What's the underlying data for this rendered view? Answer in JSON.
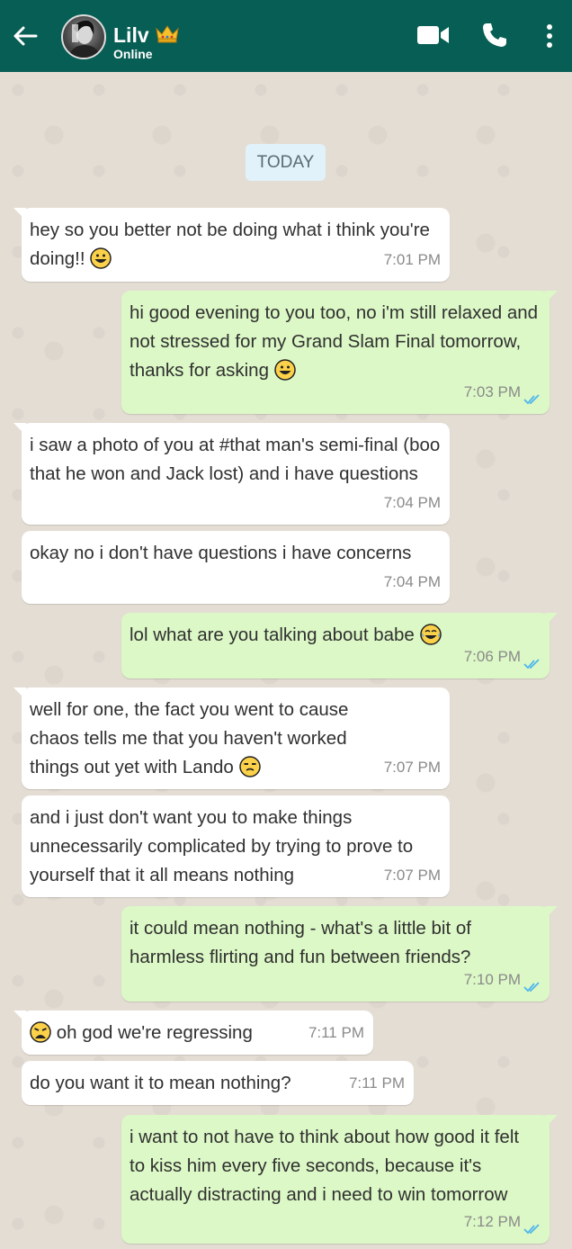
{
  "header": {
    "contact_name": "Lilv",
    "status": "Online",
    "icons": [
      "back-arrow-icon",
      "crown-icon",
      "video-call-icon",
      "phone-icon",
      "more-options-icon"
    ]
  },
  "colors": {
    "header": "#075e54",
    "incoming": "#ffffff",
    "outgoing": "#dcf8c6",
    "ticks": "#4fb6ec"
  },
  "date_badge": "TODAY",
  "messages": [
    {
      "dir": "in",
      "text": "hey so you better not be doing what i think you're doing!!",
      "emoji": "grinning-face-icon",
      "time": "7:01 PM"
    },
    {
      "dir": "out",
      "text": "hi good evening to you too, no i'm still relaxed and not stressed for my Grand Slam Final tomorrow, thanks for asking",
      "emoji": "grinning-face-icon",
      "time": "7:03 PM"
    },
    {
      "dir": "in",
      "text": "i saw a photo of you at #that man's semi-final (boo that he won and Jack lost) and i have questions",
      "time": "7:04 PM"
    },
    {
      "dir": "in",
      "text": "okay no i don't have questions i have concerns",
      "time": "7:04 PM"
    },
    {
      "dir": "out",
      "text": "lol what are you talking about babe",
      "emoji": "tears-of-joy-icon",
      "time": "7:06 PM"
    },
    {
      "dir": "in",
      "text": "well for one, the fact you went to cause chaos tells me that you haven't worked things out yet with Lando",
      "emoji": "unamused-face-icon",
      "time": "7:07 PM"
    },
    {
      "dir": "in",
      "text": "and i just don't want you to make things unnecessarily complicated by trying to prove to yourself that it all means nothing",
      "time": "7:07 PM"
    },
    {
      "dir": "out",
      "text": "it could mean nothing - what's a little bit of harmless flirting and fun between friends?",
      "time": "7:10 PM"
    },
    {
      "dir": "in",
      "text": "oh god we're regressing",
      "emoji_lead": "weary-face-icon",
      "time": "7:11 PM"
    },
    {
      "dir": "in",
      "text": "do you want it to mean nothing?",
      "time": "7:11 PM"
    },
    {
      "dir": "out",
      "text": "i want to not have to think about how good it felt to kiss him every five seconds, because it's actually distracting and i need to win tomorrow",
      "time": "7:12 PM"
    }
  ]
}
